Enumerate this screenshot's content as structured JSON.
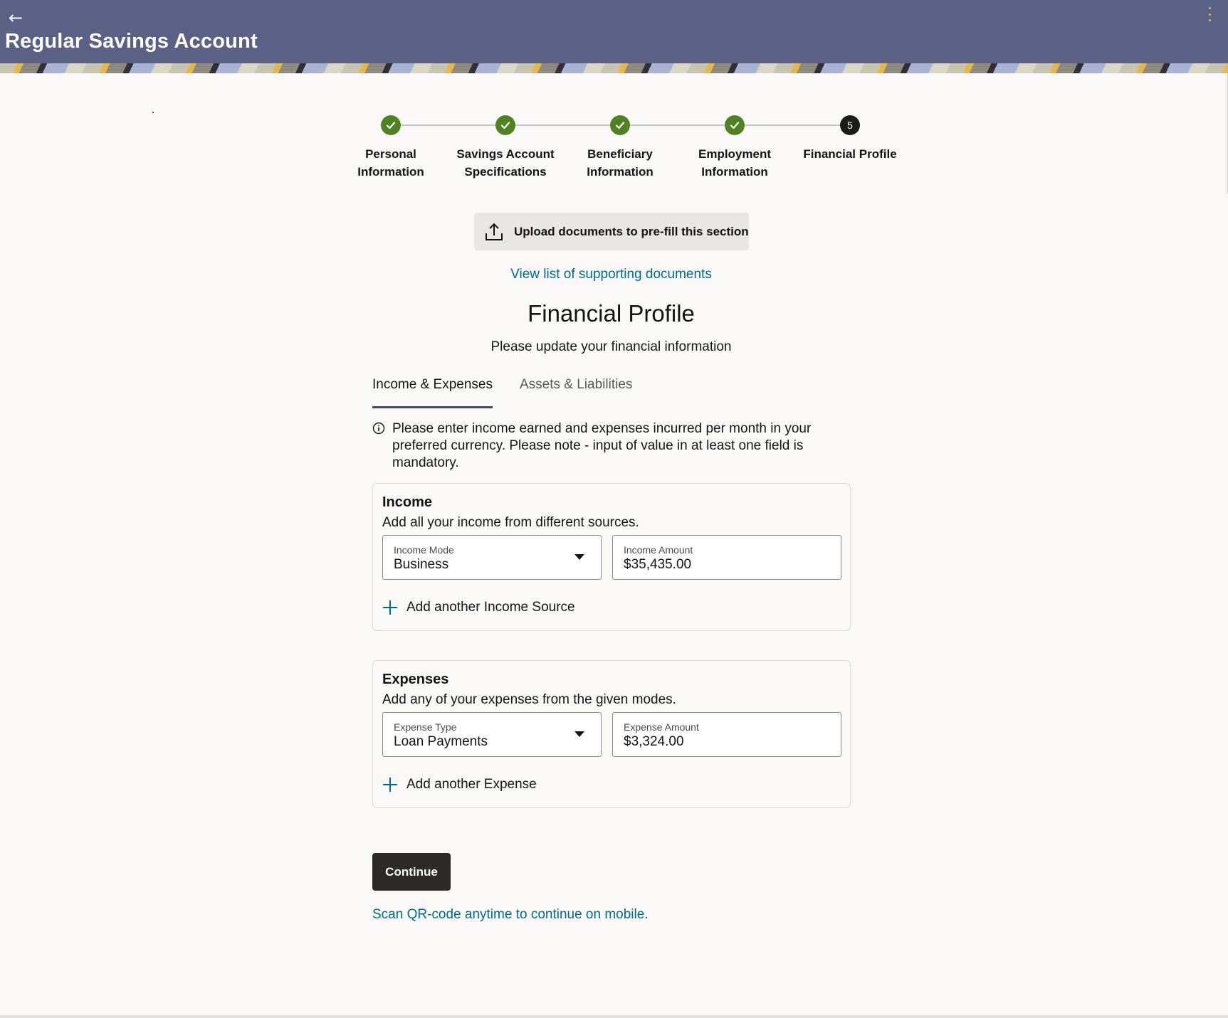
{
  "header": {
    "title": "Regular Savings Account",
    "back_icon": "arrow-left-icon",
    "menu_icon": "kebab-menu-icon",
    "bg_color": "#5b6185"
  },
  "stepper": {
    "steps": [
      {
        "label_line1": "Personal",
        "label_line2": "Information",
        "status": "done"
      },
      {
        "label_line1": "Savings Account",
        "label_line2": "Specifications",
        "status": "done"
      },
      {
        "label_line1": "Beneficiary",
        "label_line2": "Information",
        "status": "done"
      },
      {
        "label_line1": "Employment",
        "label_line2": "Information",
        "status": "done"
      },
      {
        "label_line1": "Financial Profile",
        "label_line2": "",
        "status": "current",
        "number": "5"
      }
    ],
    "done_color": "#508223"
  },
  "upload": {
    "label": "Upload documents to pre-fill this section",
    "icon": "upload-icon"
  },
  "view_docs_link": "View list of supporting documents",
  "page": {
    "title": "Financial Profile",
    "subtitle": "Please update your financial information"
  },
  "tabs": [
    {
      "label": "Income & Expenses",
      "active": true
    },
    {
      "label": "Assets & Liabilities",
      "active": false
    }
  ],
  "info": {
    "text": "Please enter income earned and expenses incurred per month in your preferred currency. Please note - input of value in at least one field is mandatory.",
    "icon": "info-icon"
  },
  "income": {
    "title": "Income",
    "description": "Add all your income from different sources.",
    "mode_label": "Income Mode",
    "mode_value": "Business",
    "amount_label": "Income Amount",
    "amount_value": "$35,435.00",
    "add_label": "Add another Income Source"
  },
  "expenses": {
    "title": "Expenses",
    "description": "Add any of your expenses from the given modes.",
    "type_label": "Expense Type",
    "type_value": "Loan Payments",
    "amount_label": "Expense Amount",
    "amount_value": "$3,324.00",
    "add_label": "Add another Expense"
  },
  "actions": {
    "continue_label": "Continue",
    "qr_link": "Scan QR-code anytime to continue on mobile."
  },
  "colors": {
    "link": "#006b8f",
    "primary_button": "#2c2a28"
  }
}
